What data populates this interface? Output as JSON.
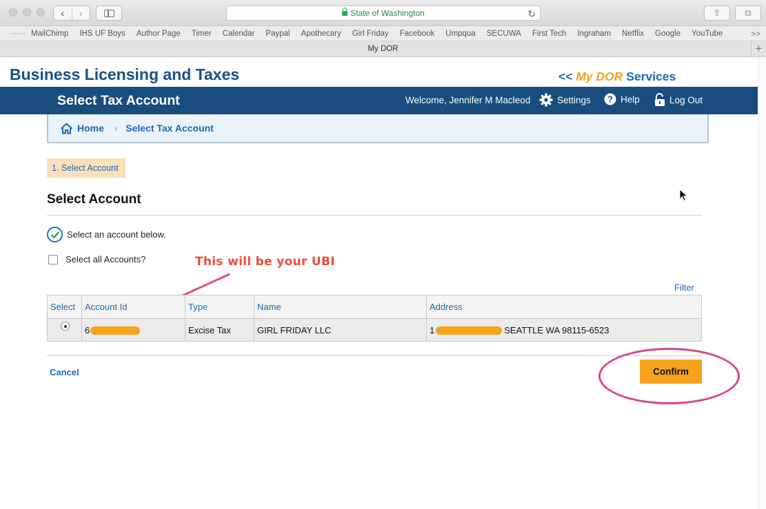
{
  "browser": {
    "url_text": "State of Washington",
    "tab_title": "My DOR",
    "bookmarks": [
      "MailChimp",
      "IHS UF Boys",
      "Author Page",
      "Timer",
      "Calendar",
      "Paypal",
      "Apothecary",
      "Girl Friday",
      "Facebook",
      "Umpqua",
      "SECUWA",
      "First Tech",
      "Ingraham",
      "Netflix",
      "Google",
      "YouTube"
    ],
    "more_label": ">>",
    "new_tab_label": "+"
  },
  "site": {
    "brand_title": "Business Licensing and Taxes",
    "mydor_prefix": "<<",
    "mydor_em": "My DOR",
    "mydor_suffix": "Services"
  },
  "header": {
    "title": "Select Tax Account",
    "welcome": "Welcome, Jennifer M Macleod",
    "settings_label": "Settings",
    "help_label": "Help",
    "logout_label": "Log Out"
  },
  "breadcrumb": {
    "home_label": "Home",
    "separator": "›",
    "current": "Select Tax Account"
  },
  "step": {
    "label": "1. Select Account"
  },
  "section": {
    "title": "Select Account",
    "instruction": "Select an account below.",
    "select_all_label": "Select all Accounts?",
    "filter_label": "Filter"
  },
  "annotation": {
    "text": "This will be your UBI"
  },
  "table": {
    "headers": [
      "Select",
      "Account Id",
      "Type",
      "Name",
      "Address"
    ],
    "rows": [
      {
        "account_id_prefix": "6",
        "account_id_suffix": "",
        "type": "Excise Tax",
        "name": "GIRL FRIDAY LLC",
        "address_prefix": "1",
        "address_visible": "SEATTLE WA 98115-6523",
        "selected": true
      }
    ]
  },
  "actions": {
    "cancel_label": "Cancel",
    "confirm_label": "Confirm"
  },
  "colors": {
    "brand_blue": "#194d7e",
    "link_blue": "#1b6ab3",
    "accent_orange": "#f7a21b",
    "annotation_red": "#ee4a3a",
    "annotation_pink": "#d9448a"
  }
}
